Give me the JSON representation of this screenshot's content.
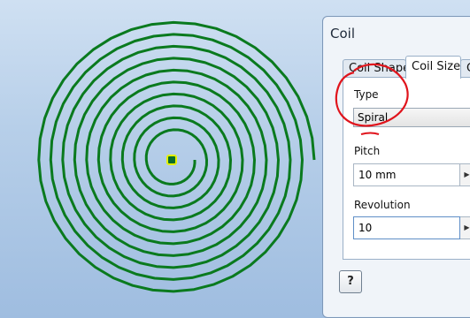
{
  "dialog": {
    "title": "Coil",
    "tabs": [
      {
        "label": "Coil Shape",
        "active": false
      },
      {
        "label": "Coil Size",
        "active": true
      },
      {
        "label": "C",
        "active": false
      }
    ],
    "type": {
      "label": "Type",
      "value": "Spiral"
    },
    "pitch": {
      "label": "Pitch",
      "value": "10 mm"
    },
    "revolution": {
      "label": "Revolution",
      "value": "10"
    },
    "help_icon": "help-icon"
  },
  "canvas": {
    "spiral_color": "#0a7a1e",
    "marker_color": "#e4f000",
    "annotation_color": "#e0141c"
  }
}
